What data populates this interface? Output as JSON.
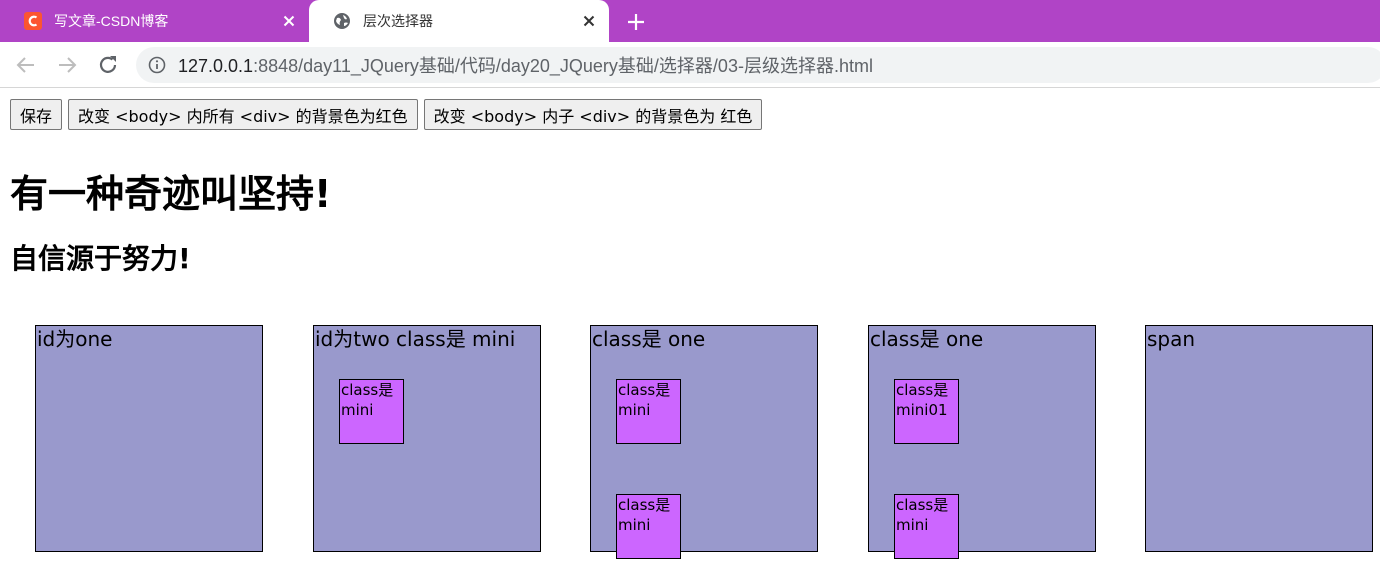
{
  "browser": {
    "tabs": [
      {
        "title": "写文章-CSDN博客",
        "favicon": "csdn-logo-icon",
        "active": false
      },
      {
        "title": "层次选择器",
        "favicon": "globe-icon",
        "active": true
      }
    ],
    "tab_colors": {
      "strip": "#b044c6",
      "csdn_logo": "#fc5531"
    },
    "url": {
      "host": "127.0.0.1",
      "rest": ":8848/day11_JQuery基础/代码/day20_JQuery基础/选择器/03-层级选择器.html"
    }
  },
  "page": {
    "buttons": [
      "保存",
      "改变 <body> 内所有 <div> 的背景色为红色",
      "改变 <body> 内子 <div> 的背景色为 红色"
    ],
    "heading1": "有一种奇迹叫坚持!",
    "heading2": "自信源于努力!",
    "box_color": "#9999cc",
    "mini_color": "#cc66ff",
    "boxes": [
      {
        "label": "id为one",
        "minis": []
      },
      {
        "label": "id为two class是 mini",
        "minis": [
          {
            "text": "class是 mini"
          }
        ]
      },
      {
        "label": "class是 one",
        "minis": [
          {
            "text": "class是 mini"
          },
          {
            "text": "class是 mini"
          }
        ]
      },
      {
        "label": "class是 one",
        "minis": [
          {
            "text": "class是 mini01"
          },
          {
            "text": "class是 mini"
          }
        ]
      },
      {
        "label": "span",
        "minis": []
      }
    ]
  }
}
